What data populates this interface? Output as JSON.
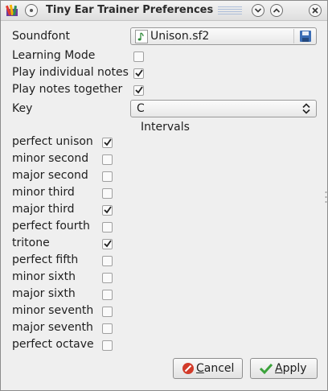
{
  "window": {
    "title": "Tiny Ear Trainer Preferences"
  },
  "colors": {
    "check": "#1f1f1f",
    "cancel_red": "#d23b2a",
    "apply_green": "#3aa23a",
    "save_blue": "#3b6db5"
  },
  "soundfont": {
    "label": "Soundfont",
    "value": "Unison.sf2",
    "icon": "music-note-icon",
    "save_icon": "floppy-disk-icon"
  },
  "learning_mode": {
    "label": "Learning Mode",
    "checked": false
  },
  "play_individual": {
    "label": "Play individual notes",
    "checked": true
  },
  "play_together": {
    "label": "Play notes together",
    "checked": true
  },
  "key": {
    "label": "Key",
    "value": "C"
  },
  "intervals_heading": "Intervals",
  "intervals": [
    {
      "label": "perfect unison",
      "checked": true
    },
    {
      "label": "minor second",
      "checked": false
    },
    {
      "label": "major second",
      "checked": false
    },
    {
      "label": "minor third",
      "checked": false
    },
    {
      "label": "major third",
      "checked": true
    },
    {
      "label": "perfect fourth",
      "checked": false
    },
    {
      "label": "tritone",
      "checked": true
    },
    {
      "label": "perfect fifth",
      "checked": false
    },
    {
      "label": "minor sixth",
      "checked": false
    },
    {
      "label": "major sixth",
      "checked": false
    },
    {
      "label": "minor seventh",
      "checked": false
    },
    {
      "label": "major seventh",
      "checked": false
    },
    {
      "label": "perfect octave",
      "checked": false
    }
  ],
  "buttons": {
    "cancel": "Cancel",
    "cancel_mnemonic": "C",
    "cancel_rest": "ancel",
    "apply": "Apply",
    "apply_mnemonic": "A",
    "apply_rest": "pply"
  }
}
